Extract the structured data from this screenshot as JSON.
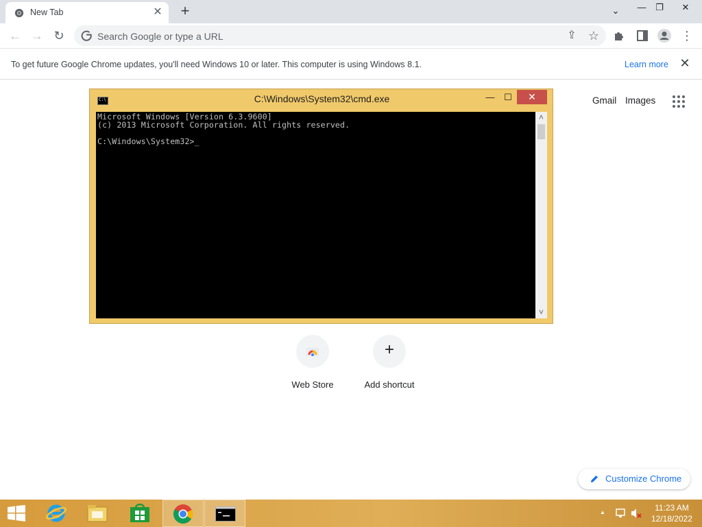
{
  "browser": {
    "tab": {
      "title": "New Tab",
      "favicon": "chrome-icon",
      "close_glyph": "✕"
    },
    "new_tab_glyph": "+",
    "window_controls": {
      "tab_search": "⌄",
      "minimize": "—",
      "restore": "❐",
      "close": "✕"
    },
    "toolbar": {
      "back": "←",
      "forward": "→",
      "reload": "↻",
      "omnibox_placeholder": "Search Google or type a URL",
      "share": "⇪",
      "bookmark": "☆",
      "extensions": "puzzle-icon",
      "side_panel": "side-panel-icon",
      "profile": "profile-icon",
      "menu": "⋮"
    },
    "infobar": {
      "message": "To get future Google Chrome updates, you'll need Windows 10 or later. This computer is using Windows 8.1.",
      "link": "Learn more",
      "close_glyph": "✕"
    }
  },
  "ntp": {
    "links": {
      "gmail": "Gmail",
      "images": "Images"
    },
    "shortcuts": [
      {
        "label": "Web Store",
        "icon": "webstore-icon"
      },
      {
        "label": "Add shortcut",
        "icon": "plus-icon",
        "glyph": "+"
      }
    ],
    "customize": {
      "label": "Customize Chrome",
      "icon": "pencil-icon"
    }
  },
  "cmd": {
    "title": "C:\\Windows\\System32\\cmd.exe",
    "controls": {
      "minimize": "—",
      "maximize": "☐",
      "close": "✕"
    },
    "lines": [
      "Microsoft Windows [Version 6.3.9600]",
      "(c) 2013 Microsoft Corporation. All rights reserved.",
      "",
      "C:\\Windows\\System32>_"
    ],
    "scroll_up": "˄",
    "scroll_down": "˅"
  },
  "taskbar": {
    "items": [
      {
        "name": "start",
        "icon": "windows-logo-icon"
      },
      {
        "name": "internet-explorer",
        "icon": "ie-icon"
      },
      {
        "name": "file-explorer",
        "icon": "folder-icon"
      },
      {
        "name": "store",
        "icon": "store-icon"
      },
      {
        "name": "chrome",
        "icon": "chrome-icon"
      },
      {
        "name": "cmd",
        "icon": "cmd-icon"
      }
    ],
    "tray": {
      "show_hidden": "▲",
      "network": "network-icon",
      "volume": "volume-muted-icon"
    },
    "clock": {
      "time": "11:23 AM",
      "date": "12/18/2022"
    }
  },
  "colors": {
    "chrome_blue": "#1a73e8",
    "tabstrip": "#dee1e6",
    "cmd_frame": "#f0c96a",
    "cmd_close": "#c7504a",
    "taskbar": "#d69b3c"
  }
}
